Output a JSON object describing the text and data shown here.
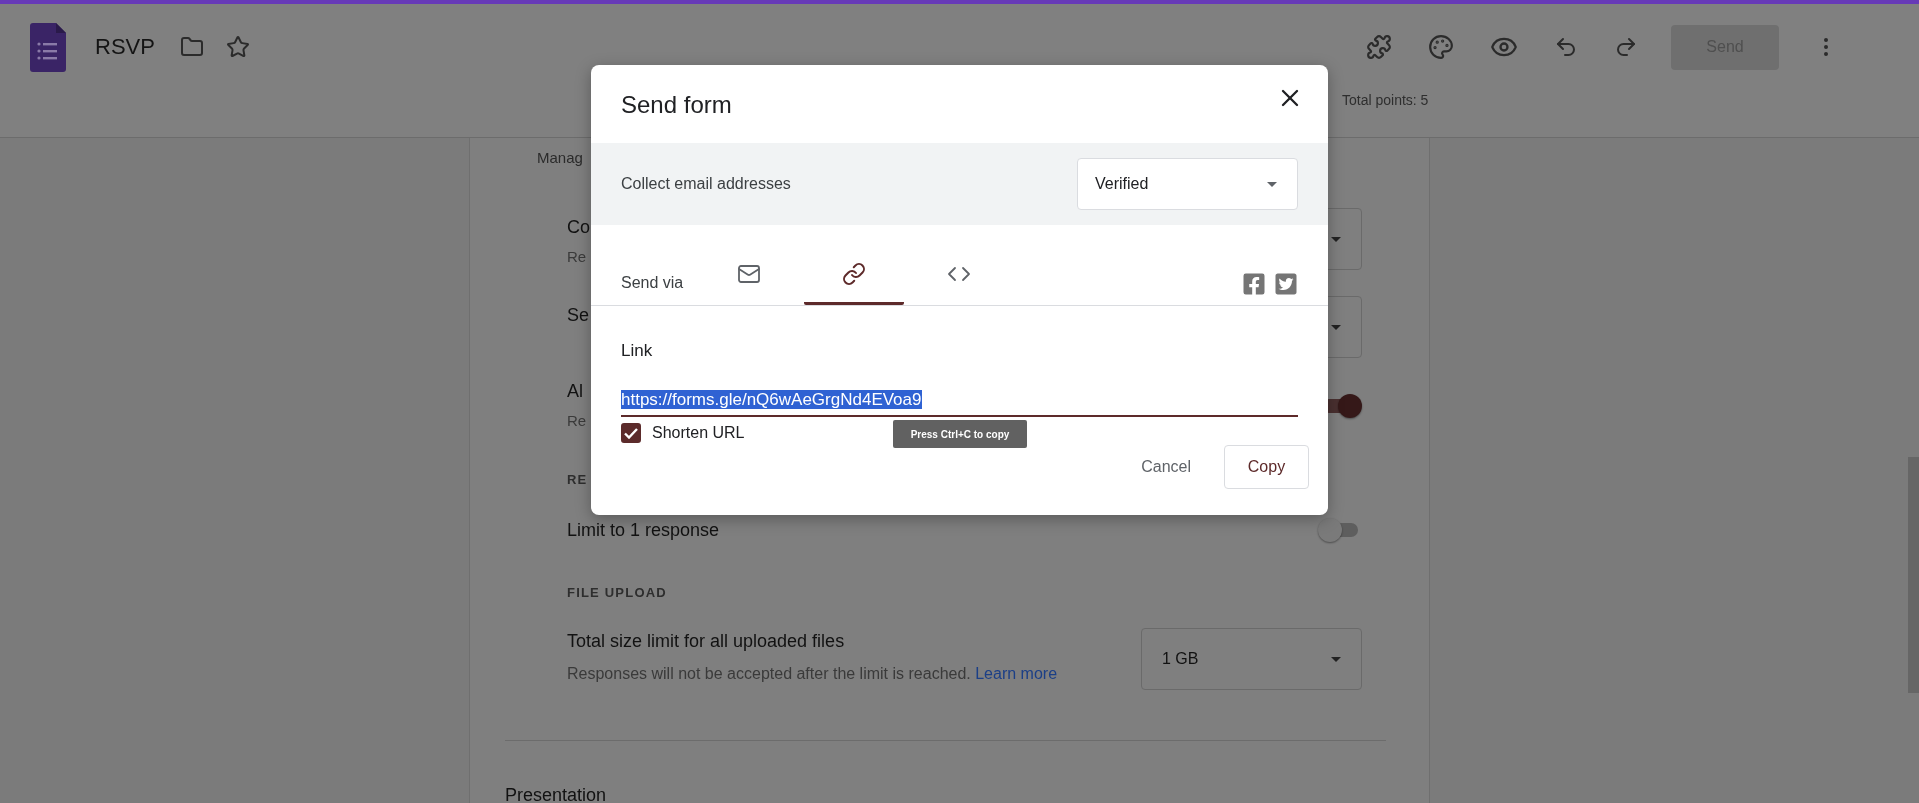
{
  "app": {
    "title": "RSVP",
    "send_label": "Send",
    "total_points": "Total points: 5"
  },
  "settings": {
    "section_title": "Manag",
    "rows": [
      {
        "kind": "select",
        "title": "Co",
        "subtitle": "Re"
      },
      {
        "kind": "select",
        "title": "Se"
      },
      {
        "kind": "toggle",
        "title": "Al",
        "subtitle": "Re",
        "on": true
      }
    ],
    "responses_heading": "RE",
    "limit": {
      "title": "Limit to 1 response",
      "on": false
    },
    "file_upload_heading": "FILE UPLOAD",
    "size_limit": {
      "title": "Total size limit for all uploaded files",
      "description": "Responses will not be accepted after the limit is reached.",
      "link": "Learn more",
      "value": "1 GB"
    },
    "presentation": "Presentation"
  },
  "dialog": {
    "title": "Send form",
    "collect_label": "Collect email addresses",
    "collect_value": "Verified",
    "send_via": "Send via",
    "tabs": [
      {
        "kind": "email",
        "selected": false
      },
      {
        "kind": "link",
        "selected": true
      },
      {
        "kind": "embed",
        "selected": false
      }
    ],
    "link_label": "Link",
    "url": "https://forms.gle/nQ6wAeGrgNd4EVoa9",
    "shorten": {
      "label": "Shorten URL",
      "checked": true
    },
    "tooltip": "Press Ctrl+C to copy",
    "cancel": "Cancel",
    "copy": "Copy"
  }
}
